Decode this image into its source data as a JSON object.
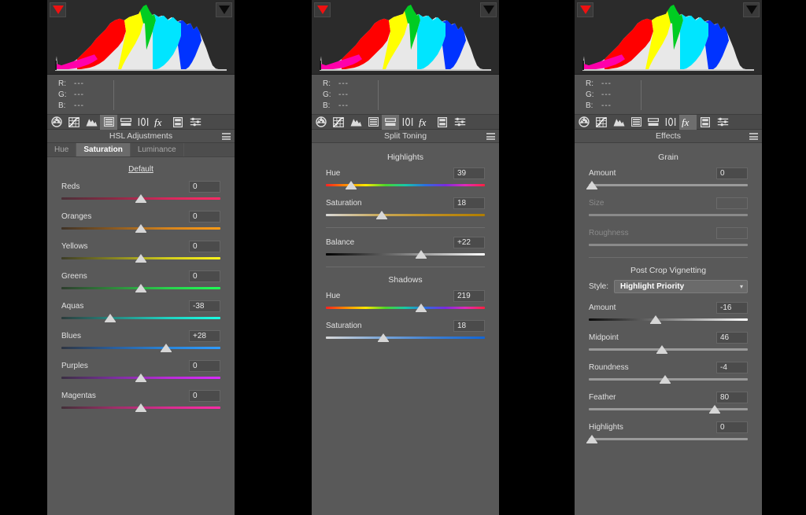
{
  "histogram": {
    "clip_left_icon": "shadow-clipping-triangle",
    "clip_right_icon": "highlight-clipping-triangle",
    "clip_left_color": "#ee1111",
    "clip_right_color": "#0b0b0b"
  },
  "readout": {
    "rows": [
      {
        "label": "R:",
        "value": "---"
      },
      {
        "label": "G:",
        "value": "---"
      },
      {
        "label": "B:",
        "value": "---"
      }
    ]
  },
  "toolbar": {
    "icons": [
      "basic-aperture-icon",
      "tone-curve-icon",
      "detail-mountain-icon",
      "hsl-adjustments-icon",
      "split-toning-icon",
      "lens-corrections-icon",
      "effects-fx-icon",
      "camera-calibration-icon",
      "presets-sliders-icon"
    ]
  },
  "panels": [
    {
      "id": "hsl",
      "title": "HSL Adjustments",
      "menu_icon": "panel-menu-icon",
      "tabs": [
        {
          "label": "Hue",
          "active": false
        },
        {
          "label": "Saturation",
          "active": true
        },
        {
          "label": "Luminance",
          "active": false
        }
      ],
      "default_link": "Default",
      "active_tool_index": 3,
      "sliders": [
        {
          "label": "Reds",
          "value": "0",
          "pos": 50,
          "gradient": "linear-gradient(to right,#4a3038,#8c2a45,#d6285c,#ff2b66)"
        },
        {
          "label": "Oranges",
          "value": "0",
          "pos": 50,
          "gradient": "linear-gradient(to right,#3f3327,#8a5a22,#d4831d,#ff9c15)"
        },
        {
          "label": "Yellows",
          "value": "0",
          "pos": 50,
          "gradient": "linear-gradient(to right,#3d3d28,#878522,#d0cc1c,#fff61a)"
        },
        {
          "label": "Greens",
          "value": "0",
          "pos": 50,
          "gradient": "linear-gradient(to right,#2e3d2e,#2f8a3c,#2ad14d,#1eff55)"
        },
        {
          "label": "Aquas",
          "value": "-38",
          "pos": 30.5,
          "gradient": "linear-gradient(to right,#2c3c3c,#278a82,#20d0c0,#19ffe4)"
        },
        {
          "label": "Blues",
          "value": "+28",
          "pos": 66,
          "gradient": "linear-gradient(to right,#2e3542,#2a5f9e,#2a85d8,#2f9bff)"
        },
        {
          "label": "Purples",
          "value": "0",
          "pos": 50,
          "gradient": "linear-gradient(to right,#3a2f42,#7b2f9e,#b82dd6,#d92bff)"
        },
        {
          "label": "Magentas",
          "value": "0",
          "pos": 50,
          "gradient": "linear-gradient(to right,#422f38,#9e2f68,#d62d8e,#ff2ba6)"
        }
      ]
    },
    {
      "id": "split",
      "title": "Split Toning",
      "menu_icon": "panel-menu-icon",
      "active_tool_index": 4,
      "sections": [
        {
          "heading": "Highlights",
          "sliders": [
            {
              "label": "Hue",
              "value": "39",
              "pos": 16,
              "gradient": "linear-gradient(to right,#ff2020,#ff8c00,#ffe800,#4bd62a,#18c8a8,#2a6fe0,#7a2ae0,#e02ab8,#ff2040)"
            },
            {
              "label": "Saturation",
              "value": "18",
              "pos": 35,
              "gradient": "linear-gradient(to right,#d8d8d8,#c9a95a,#c08f20,#b07d00)"
            }
          ]
        },
        {
          "heading": "",
          "sliders": [
            {
              "label": "Balance",
              "value": "+22",
              "pos": 60,
              "gradient": "linear-gradient(to right,#000000,#ffffff)"
            }
          ]
        },
        {
          "heading": "Shadows",
          "sliders": [
            {
              "label": "Hue",
              "value": "219",
              "pos": 60,
              "gradient": "linear-gradient(to right,#ff2020,#ff8c00,#ffe800,#4bd62a,#18c8a8,#2a6fe0,#7a2ae0,#e02ab8,#ff2040)"
            },
            {
              "label": "Saturation",
              "value": "18",
              "pos": 36,
              "gradient": "linear-gradient(to right,#d8d8d8,#7ea8d8,#3f7fd0,#1066d8)"
            }
          ]
        }
      ]
    },
    {
      "id": "fx",
      "title": "Effects",
      "menu_icon": "panel-menu-icon",
      "active_tool_index": 6,
      "grain_heading": "Grain",
      "grain_sliders": [
        {
          "label": "Amount",
          "value": "0",
          "pos": 2,
          "disabled": false,
          "gradient": "linear-gradient(to right,#9a9a9a,#9a9a9a)"
        },
        {
          "label": "Size",
          "value": "",
          "pos": -1,
          "disabled": true,
          "gradient": "linear-gradient(to right,#8a8a8a,#8a8a8a)"
        },
        {
          "label": "Roughness",
          "value": "",
          "pos": -1,
          "disabled": true,
          "gradient": "linear-gradient(to right,#8a8a8a,#8a8a8a)"
        }
      ],
      "vignette_heading": "Post Crop Vignetting",
      "style_label": "Style:",
      "style_value": "Highlight Priority",
      "style_chevron": "chevron-down-icon",
      "vignette_sliders": [
        {
          "label": "Amount",
          "value": "-16",
          "pos": 42,
          "gradient": "linear-gradient(to right,#0a0a0a,#ffffff)"
        },
        {
          "label": "Midpoint",
          "value": "46",
          "pos": 46,
          "gradient": "linear-gradient(to right,#9a9a9a,#9a9a9a)"
        },
        {
          "label": "Roundness",
          "value": "-4",
          "pos": 48,
          "gradient": "linear-gradient(to right,#9a9a9a,#9a9a9a)"
        },
        {
          "label": "Feather",
          "value": "80",
          "pos": 79,
          "gradient": "linear-gradient(to right,#9a9a9a,#9a9a9a)"
        },
        {
          "label": "Highlights",
          "value": "0",
          "pos": 2,
          "gradient": "linear-gradient(to right,#9a9a9a,#9a9a9a)"
        }
      ]
    }
  ]
}
